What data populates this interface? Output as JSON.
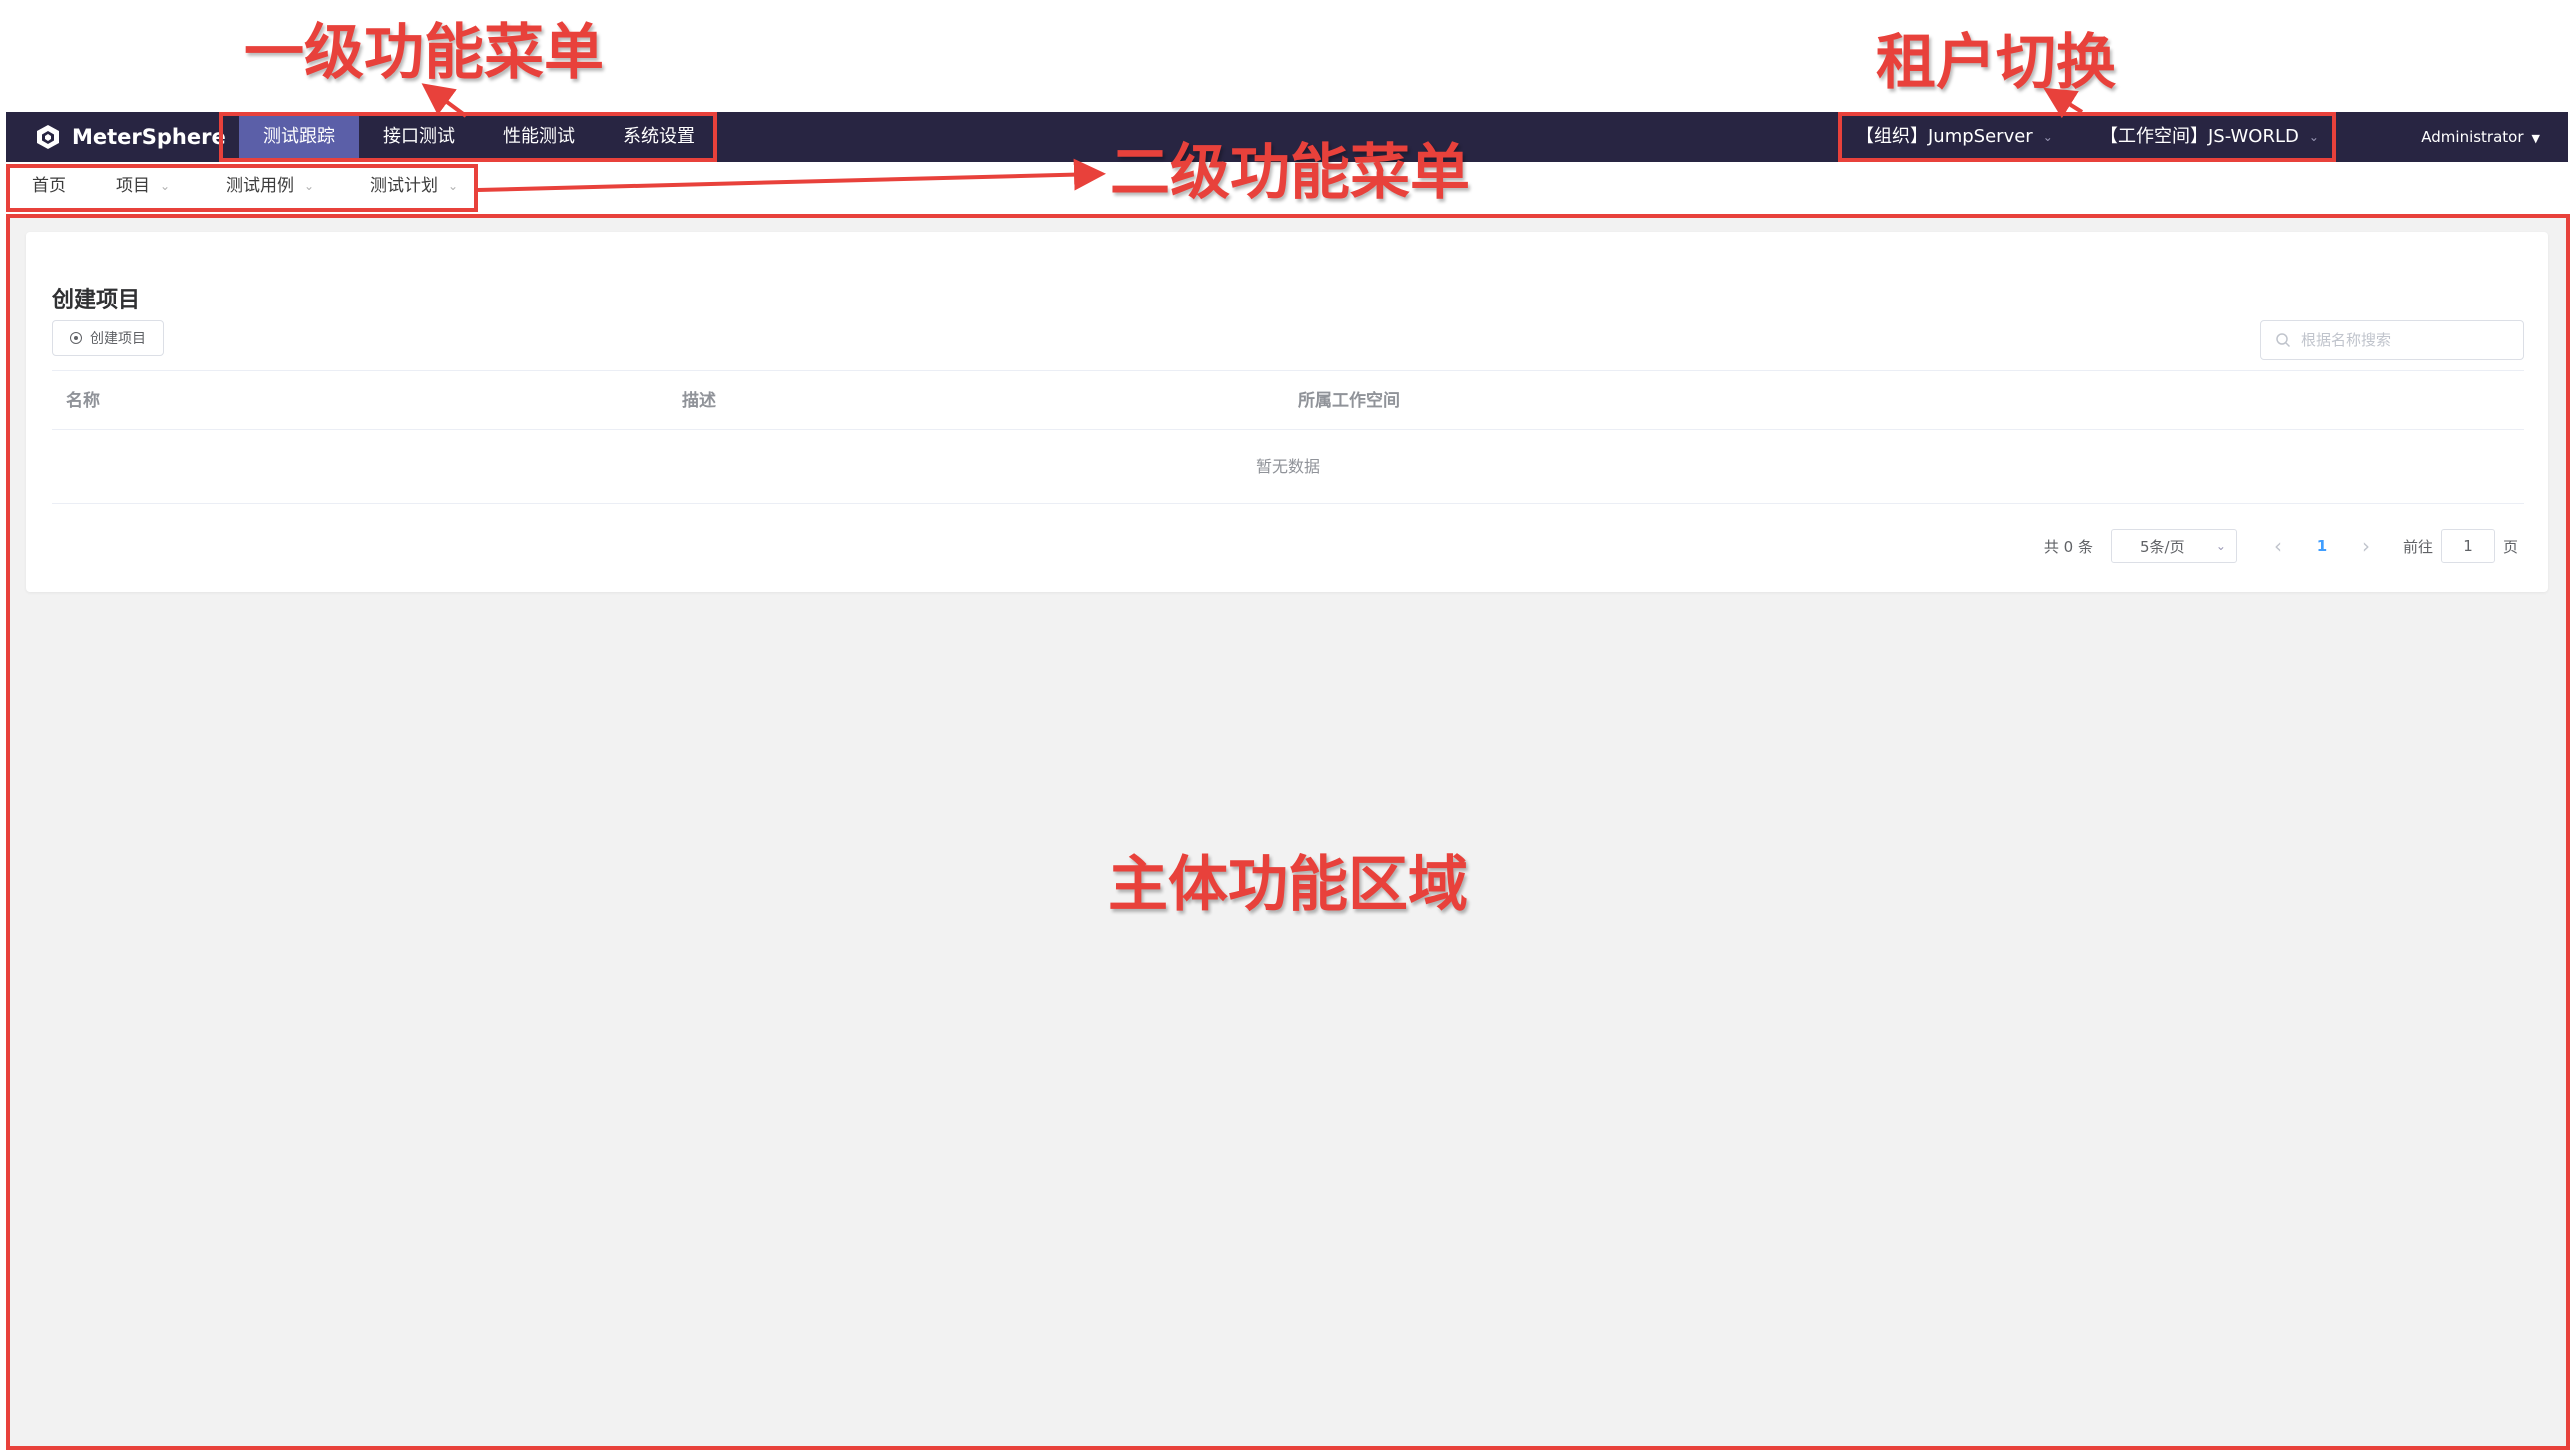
{
  "app": {
    "name": "MeterSphere"
  },
  "top_menu": [
    {
      "label": "测试跟踪",
      "active": true
    },
    {
      "label": "接口测试",
      "active": false
    },
    {
      "label": "性能测试",
      "active": false
    },
    {
      "label": "系统设置",
      "active": false
    }
  ],
  "tenant": {
    "org": "【组织】JumpServer",
    "workspace": "【工作空间】JS-WORLD"
  },
  "user": {
    "name": "Administrator"
  },
  "sub_menu": [
    {
      "label": "首页",
      "dropdown": false
    },
    {
      "label": "项目",
      "dropdown": true
    },
    {
      "label": "测试用例",
      "dropdown": true
    },
    {
      "label": "测试计划",
      "dropdown": true
    }
  ],
  "main": {
    "title": "创建项目",
    "create_button": "创建项目",
    "search_placeholder": "根据名称搜索",
    "columns": [
      "名称",
      "描述",
      "所属工作空间"
    ],
    "empty_text": "暂无数据"
  },
  "pagination": {
    "total": "共 0 条",
    "page_size": "5条/页",
    "current_page": "1",
    "goto_label": "前往",
    "goto_value": "1",
    "page_suffix": "页"
  },
  "annotations": {
    "level1": "一级功能菜单",
    "level2": "二级功能菜单",
    "tenant": "租户切换",
    "main_area": "主体功能区域"
  },
  "colors": {
    "nav_bg": "#282542",
    "active_menu": "#5b5fa8",
    "annotation": "#e8413b",
    "link": "#409eff"
  }
}
